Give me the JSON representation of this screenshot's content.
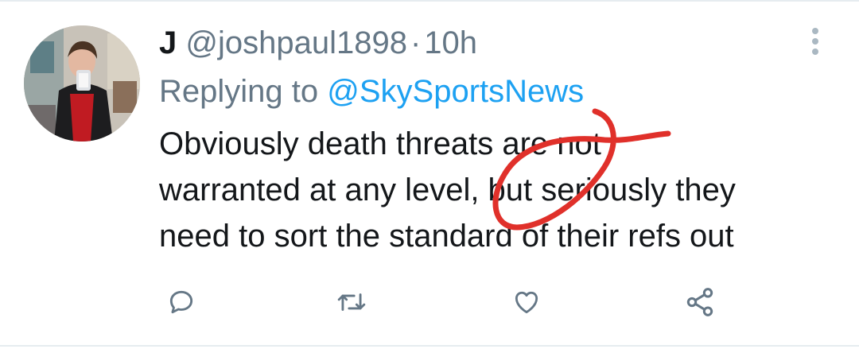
{
  "tweet": {
    "display_name": "J",
    "handle": "@joshpaul1898",
    "separator": "·",
    "timestamp": "10h",
    "reply_prefix": "Replying to",
    "reply_to": "@SkySportsNews",
    "text_lines": [
      "Obviously death threats are not",
      "warranted at any level, but seriously they",
      "need to sort the standard of their refs out"
    ]
  },
  "icons": {
    "more": "more-vertical-icon",
    "reply": "reply-icon",
    "retweet": "retweet-icon",
    "like": "heart-icon",
    "share": "share-icon"
  },
  "colors": {
    "primary_text": "#14171a",
    "secondary_text": "#657786",
    "link": "#1da1f2",
    "annotation": "#e0302a"
  }
}
